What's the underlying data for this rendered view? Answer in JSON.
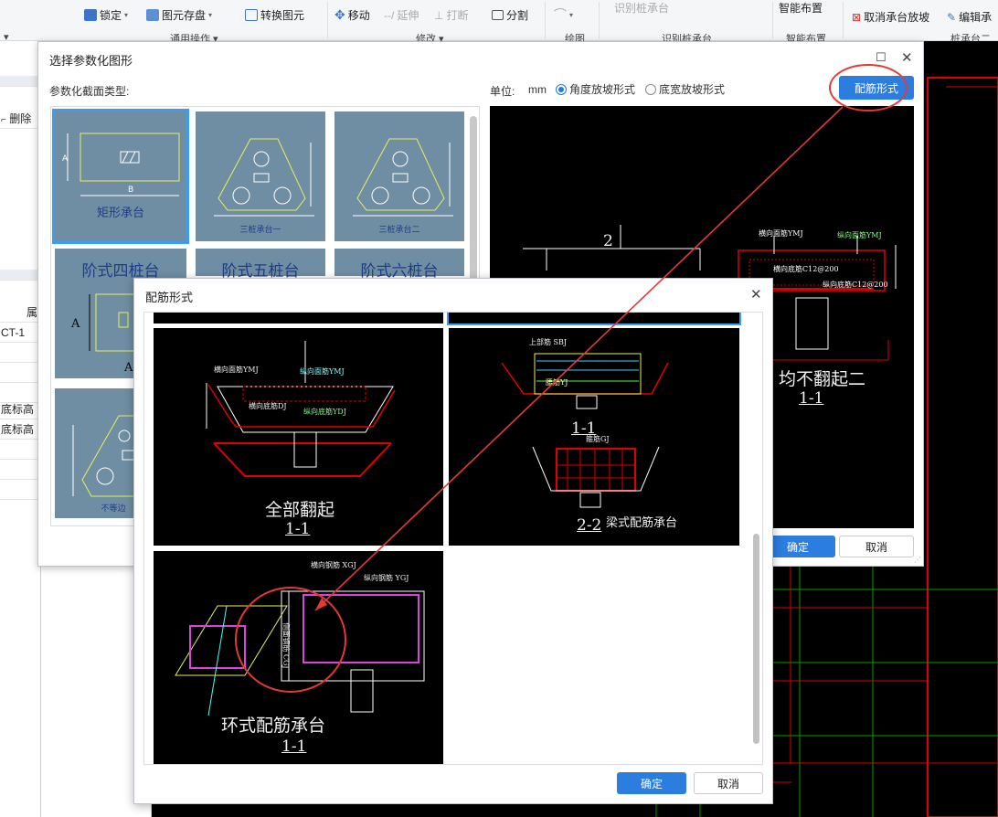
{
  "ribbon": {
    "lock": "锁定",
    "save_element": "图元存盘",
    "convert_element": "转换图元",
    "move": "移动",
    "extend": "延伸",
    "break": "打断",
    "split": "分割",
    "identify_pile_cap": "识别桩承台",
    "smart_layout": "智能布置",
    "cancel_slope": "取消承台放坡",
    "edit_rebar": "编辑承",
    "group_general": "通用操作",
    "group_modify": "修改",
    "group_draw": "绘图",
    "group_identify": "识别桩承台",
    "group_smart": "智能布置",
    "group_pile_cap2": "桩承台二"
  },
  "left_panel": {
    "delete": "删除",
    "item_ct1": "CT-1",
    "bottom_elev_1": "底标高",
    "bottom_elev_2": "底标高",
    "col_trunc": "属"
  },
  "dialog_param": {
    "title": "选择参数化图形",
    "section_type_label": "参数化截面类型:",
    "unit_label": "单位:",
    "unit_value": "mm",
    "radio_angle": "角度放坡形式",
    "radio_width": "底宽放坡形式",
    "rebar_form_button": "配筋形式",
    "ok": "确定",
    "cancel": "取消",
    "thumbs": [
      {
        "caption": "矩形承台"
      },
      {
        "caption": "三桩承台一"
      },
      {
        "caption": "三桩承台二"
      },
      {
        "caption": "阶式四桩台"
      },
      {
        "caption": "阶式五桩台"
      },
      {
        "caption": "阶式六桩台"
      },
      {
        "caption": "不等边"
      }
    ],
    "preview": {
      "label_2": "2",
      "horiz_top": "横向面筋YMJ",
      "vert_top": "纵向面筋YMJ",
      "horiz_bottom": "横向底筋C12@200",
      "vert_bottom": "纵向底筋C12@200",
      "caption": "均不翻起二",
      "section": "1-1"
    }
  },
  "dialog_rebar": {
    "title": "配筋形式",
    "ok": "确定",
    "cancel": "取消",
    "panels": [
      {
        "caption": "全部翻起",
        "section": "1-1",
        "horiz_top": "横向面筋YMJ",
        "vert_top": "纵向面筋YMJ",
        "horiz_bottom": "横向底筋DJ",
        "vert_bottom": "纵向底筋YDJ"
      },
      {
        "caption": "梁式配筋承台",
        "section_a": "1-1",
        "section_b": "2-2",
        "top_rebar": "上部筋 SBJ",
        "waist_rebar": "腰筋YJ",
        "stirrup": "箍筋GJ"
      },
      {
        "caption": "环式配筋承台",
        "section": "1-1",
        "horiz": "横向钢筋 XGJ",
        "vert": "纵向钢筋 YGJ",
        "side": "侧面钢筋 CGJ"
      }
    ]
  },
  "colors": {
    "primary": "#2b7de0",
    "thumb_bg": "#6f8ea3",
    "annotation": "#e53935",
    "cad_green": "#00c800",
    "cad_red": "#e00000"
  }
}
